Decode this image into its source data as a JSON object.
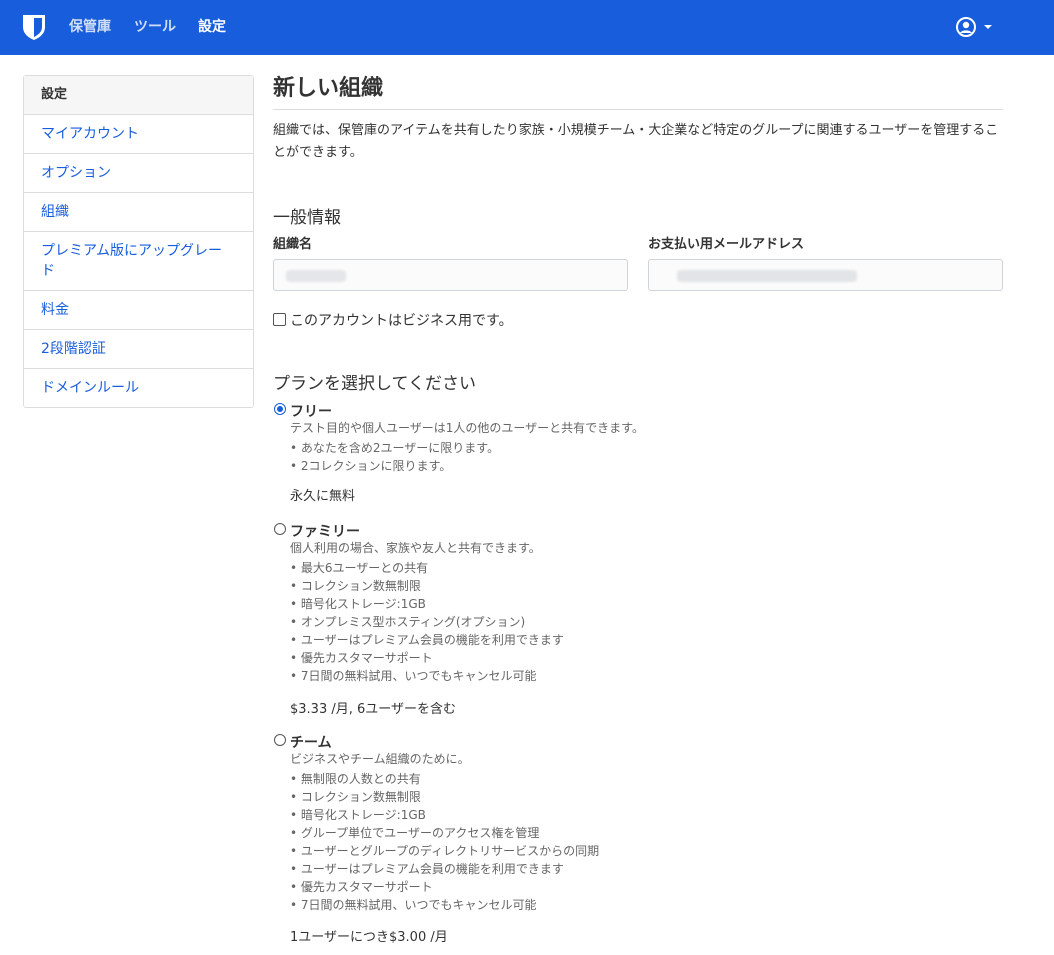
{
  "nav": {
    "vault": "保管庫",
    "tools": "ツール",
    "settings": "設定"
  },
  "sidebar": {
    "heading": "設定",
    "items": [
      {
        "label": "マイアカウント"
      },
      {
        "label": "オプション"
      },
      {
        "label": "組織"
      },
      {
        "label": "プレミアム版にアップグレード"
      },
      {
        "label": "料金"
      },
      {
        "label": "2段階認証"
      },
      {
        "label": "ドメインルール"
      }
    ]
  },
  "page": {
    "title": "新しい組織",
    "intro": "組織では、保管庫のアイテムを共有したり家族・小規模チーム・大企業など特定のグループに関連するユーザーを管理することができます。"
  },
  "general": {
    "title": "一般情報",
    "org_name_label": "組織名",
    "billing_email_label": "お支払い用メールアドレス",
    "business_checkbox_label": "このアカウントはビジネス用です。"
  },
  "plans": {
    "title": "プランを選択してください",
    "free": {
      "name": "フリー",
      "description": "テスト目的や個人ユーザーは1人の他のユーザーと共有できます。",
      "features": [
        "あなたを含め2ユーザーに限ります。",
        "2コレクションに限ります。"
      ],
      "price": "永久に無料"
    },
    "family": {
      "name": "ファミリー",
      "description": "個人利用の場合、家族や友人と共有できます。",
      "features": [
        "最大6ユーザーとの共有",
        "コレクション数無制限",
        "暗号化ストレージ:1GB",
        "オンプレミス型ホスティング(オプション)",
        "ユーザーはプレミアム会員の機能を利用できます",
        "優先カスタマーサポート",
        "7日間の無料試用、いつでもキャンセル可能"
      ],
      "price": "$3.33 /月, 6ユーザーを含む"
    },
    "team": {
      "name": "チーム",
      "description": "ビジネスやチーム組織のために。",
      "features": [
        "無制限の人数との共有",
        "コレクション数無制限",
        "暗号化ストレージ:1GB",
        "グループ単位でユーザーのアクセス権を管理",
        "ユーザーとグループのディレクトリサービスからの同期",
        "ユーザーはプレミアム会員の機能を利用できます",
        "優先カスタマーサポート",
        "7日間の無料試用、いつでもキャンセル可能"
      ],
      "price": "1ユーザーにつき$3.00 /月"
    }
  },
  "colors": {
    "brand": "#175ddc",
    "link": "#175ddc"
  },
  "icons": {
    "logo": "bitwarden-shield-icon",
    "profile": "user-circle-icon"
  }
}
